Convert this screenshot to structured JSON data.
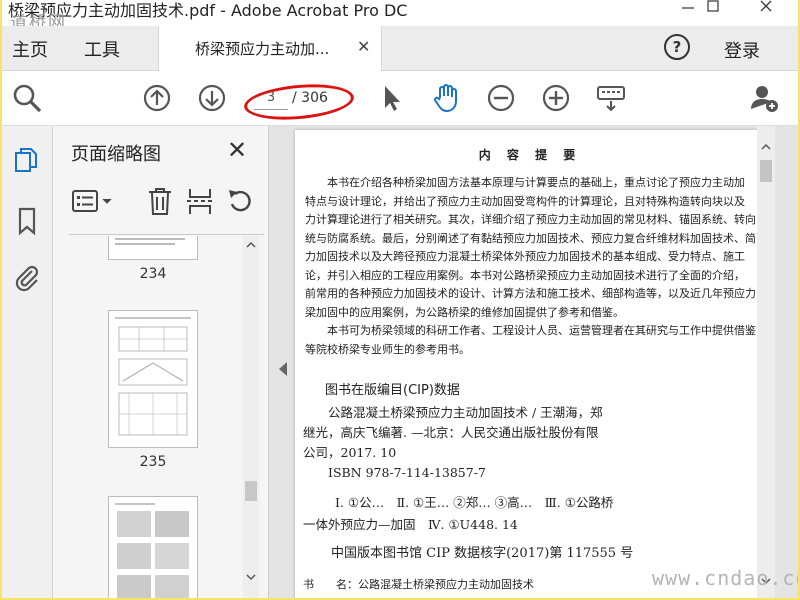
{
  "window": {
    "title": "桥梁预应力主动加固技术.pdf - Adobe Acrobat Pro DC",
    "watermark_top": "道桥网"
  },
  "tabs": {
    "home": "主页",
    "tools": "工具",
    "document": "桥梁预应力主动加...",
    "help_glyph": "?",
    "login": "登录"
  },
  "toolbar": {
    "current_page": "3",
    "total_pages": "/ 306"
  },
  "thumbnails": {
    "title": "页面缩略图",
    "pages": [
      "234",
      "235"
    ]
  },
  "document": {
    "heading": "内 容 提 要",
    "summary_lines": [
      "　　本书在介绍各种桥梁加固方法基本原理与计算要点的基础上，重点讨论了预应力主动加",
      "特点与设计理论，并给出了预应力主动加固受弯构件的计算理论，且对特殊构造转向块以及",
      "力计算理论进行了相关研究。其次，详细介绍了预应力主动加固的常见材料、锚固系统、转向",
      "统与防腐系统。最后，分别阐述了有黏结预应力加固技术、预应力复合纤维材料加固技术、简",
      "力加固技术以及大跨径预应力混凝土桥梁体外预应力加固技术的基本组成、受力特点、施工",
      "论，并引入相应的工程应用案例。本书对公路桥梁预应力主动加固技术进行了全面的介绍，",
      "前常用的各种预应力加固技术的设计、计算方法和施工技术、细部构造等，以及近几年预应力",
      "梁加固中的应用案例，为公路桥梁的维修加固提供了参考和借鉴。",
      "　　本书可为桥梁领域的科研工作者、工程设计人员、运营管理者在其研究与工作中提供借鉴",
      "等院校桥梁专业师生的参考用书。"
    ],
    "cip_title": "图书在版编目(CIP)数据",
    "cip_lines": [
      "　　公路混凝土桥梁预应力主动加固技术 / 王潮海，郑",
      "继光，高庆飞编著. —北京：人民交通出版社股份有限",
      "公司，2017. 10",
      "　　ISBN 978-7-114-13857-7"
    ],
    "classification_line1": "Ⅰ. ①公…　Ⅱ. ①王…  ②郑…  ③高…　Ⅲ. ①公路桥",
    "classification_line2": "一体外预应力—加固　Ⅳ. ①U448. 14",
    "cip_number": "中国版本图书馆 CIP 数据核字(2017)第 117555 号",
    "bottom_line": "书　　名：公路混凝土桥梁预应力主动加固技术",
    "watermark_bottom": "www.cndao.com"
  },
  "colors": {
    "accent_blue": "#1a73c8",
    "annotation_red": "#d11111",
    "frame_yellow": "#f7e36a"
  }
}
